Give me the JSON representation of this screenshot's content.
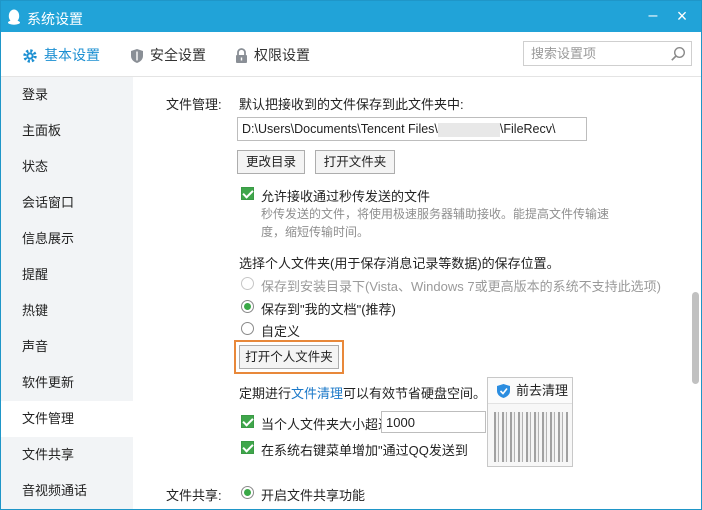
{
  "window": {
    "title": "系统设置"
  },
  "tabs": [
    {
      "label": "基本设置",
      "icon": "gear-icon",
      "active": true
    },
    {
      "label": "安全设置",
      "icon": "shield-icon",
      "active": false
    },
    {
      "label": "权限设置",
      "icon": "lock-icon",
      "active": false
    }
  ],
  "search": {
    "placeholder": "搜索设置项"
  },
  "sidebar": {
    "items": [
      {
        "label": "登录"
      },
      {
        "label": "主面板"
      },
      {
        "label": "状态"
      },
      {
        "label": "会话窗口"
      },
      {
        "label": "信息展示"
      },
      {
        "label": "提醒"
      },
      {
        "label": "热键"
      },
      {
        "label": "声音"
      },
      {
        "label": "软件更新"
      },
      {
        "label": "文件管理",
        "active": true
      },
      {
        "label": "文件共享"
      },
      {
        "label": "音视频通话"
      }
    ]
  },
  "file_management": {
    "section_label": "文件管理:",
    "save_desc": "默认把接收到的文件保存到此文件夹中:",
    "path_prefix": "D:\\Users\\Documents\\Tencent Files\\",
    "path_suffix": "\\FileRecv\\",
    "change_dir_button": "更改目录",
    "open_folder_button": "打开文件夹",
    "allow_flash_label": "允许接收通过秒传发送的文件",
    "allow_flash_checked": true,
    "flash_hint_line1": "秒传发送的文件，将使用极速服务器辅助接收。能提高文件传输速",
    "flash_hint_line2": "度，缩短传输时间。",
    "personal_folder_desc": "选择个人文件夹(用于保存消息记录等数据)的保存位置。",
    "radio_install_dir": "保存到安装目录下(Vista、Windows 7或更高版本的系统不支持此选项)",
    "radio_my_docs": "保存到\"我的文档\"(推荐)",
    "radio_custom": "自定义",
    "open_personal_folder_button": "打开个人文件夹",
    "cleanup_prefix": "定期进行",
    "cleanup_link": "文件清理",
    "cleanup_suffix": "可以有效节省硬盘空间。",
    "go_clean_button": "前去清理",
    "size_limit_label": "当个人文件夹大小超过",
    "size_limit_value": "1000",
    "context_menu_label": "在系统右键菜单增加\"通过QQ发送到"
  },
  "file_sharing": {
    "section_label": "文件共享:",
    "enable_label": "开启文件共享功能"
  },
  "colors": {
    "titlebar": "#21a3d8",
    "accent": "#1b8fd2",
    "highlight_border": "#e8883a",
    "check_green": "#3fa64b"
  }
}
